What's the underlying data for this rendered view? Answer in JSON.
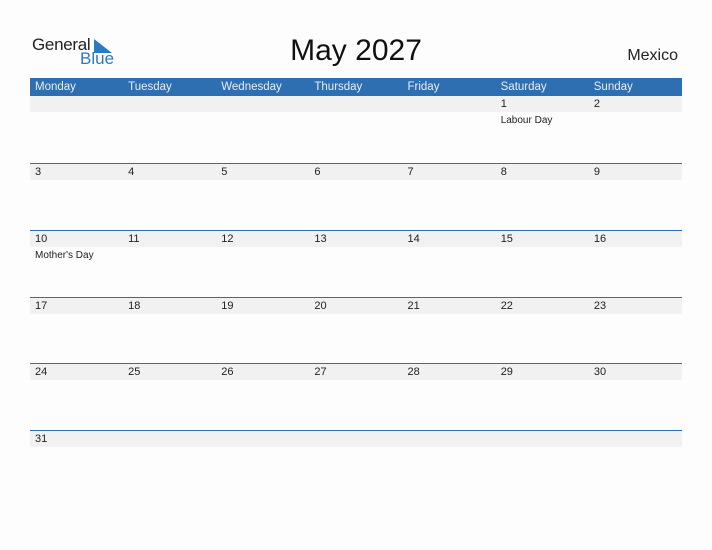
{
  "logo": {
    "general": "General",
    "blue": "Blue"
  },
  "title": "May 2027",
  "country": "Mexico",
  "weekdays": [
    "Monday",
    "Tuesday",
    "Wednesday",
    "Thursday",
    "Friday",
    "Saturday",
    "Sunday"
  ],
  "weeks": [
    [
      {
        "d": ""
      },
      {
        "d": ""
      },
      {
        "d": ""
      },
      {
        "d": ""
      },
      {
        "d": ""
      },
      {
        "d": "1",
        "e": "Labour Day"
      },
      {
        "d": "2"
      }
    ],
    [
      {
        "d": "3"
      },
      {
        "d": "4"
      },
      {
        "d": "5"
      },
      {
        "d": "6"
      },
      {
        "d": "7"
      },
      {
        "d": "8"
      },
      {
        "d": "9"
      }
    ],
    [
      {
        "d": "10",
        "e": "Mother's Day"
      },
      {
        "d": "11"
      },
      {
        "d": "12"
      },
      {
        "d": "13"
      },
      {
        "d": "14"
      },
      {
        "d": "15"
      },
      {
        "d": "16"
      }
    ],
    [
      {
        "d": "17"
      },
      {
        "d": "18"
      },
      {
        "d": "19"
      },
      {
        "d": "20"
      },
      {
        "d": "21"
      },
      {
        "d": "22"
      },
      {
        "d": "23"
      }
    ],
    [
      {
        "d": "24"
      },
      {
        "d": "25"
      },
      {
        "d": "26"
      },
      {
        "d": "27"
      },
      {
        "d": "28"
      },
      {
        "d": "29"
      },
      {
        "d": "30"
      }
    ],
    [
      {
        "d": "31"
      },
      {
        "d": ""
      },
      {
        "d": ""
      },
      {
        "d": ""
      },
      {
        "d": ""
      },
      {
        "d": ""
      },
      {
        "d": ""
      }
    ]
  ],
  "colors": {
    "accent": "#2e6fb1",
    "logo_blue": "#2a7bc1",
    "strip": "#f1f1f1"
  }
}
